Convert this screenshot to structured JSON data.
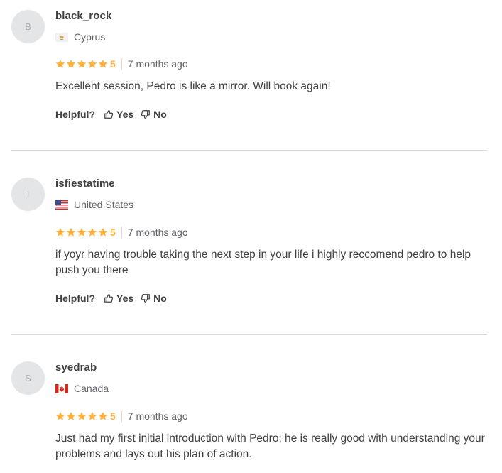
{
  "reviews": [
    {
      "avatar_initial": "B",
      "username": "black_rock",
      "country": "Cyprus",
      "flag": "cyprus-flag",
      "rating": "5",
      "time_ago": "7 months ago",
      "text": "Excellent session, Pedro is like a mirror. Will book again!",
      "helpful_label": "Helpful?",
      "yes_label": "Yes",
      "no_label": "No"
    },
    {
      "avatar_initial": "I",
      "username": "isfiestatime",
      "country": "United States",
      "flag": "us-flag",
      "rating": "5",
      "time_ago": "7 months ago",
      "text": "if yoyr having trouble taking the next step in your life i highly reccomend pedro to help push you there",
      "helpful_label": "Helpful?",
      "yes_label": "Yes",
      "no_label": "No"
    },
    {
      "avatar_initial": "S",
      "username": "syedrab",
      "country": "Canada",
      "flag": "canada-flag",
      "rating": "5",
      "time_ago": "7 months ago",
      "text": "Just had my first initial introduction with Pedro; he is really good with understanding your problems and lays out his plan of action."
    }
  ],
  "colors": {
    "star": "#ffb33e",
    "text": "#404145",
    "muted": "#62646a",
    "divider": "#dadbdd",
    "avatar_bg": "#e4e5e7"
  }
}
